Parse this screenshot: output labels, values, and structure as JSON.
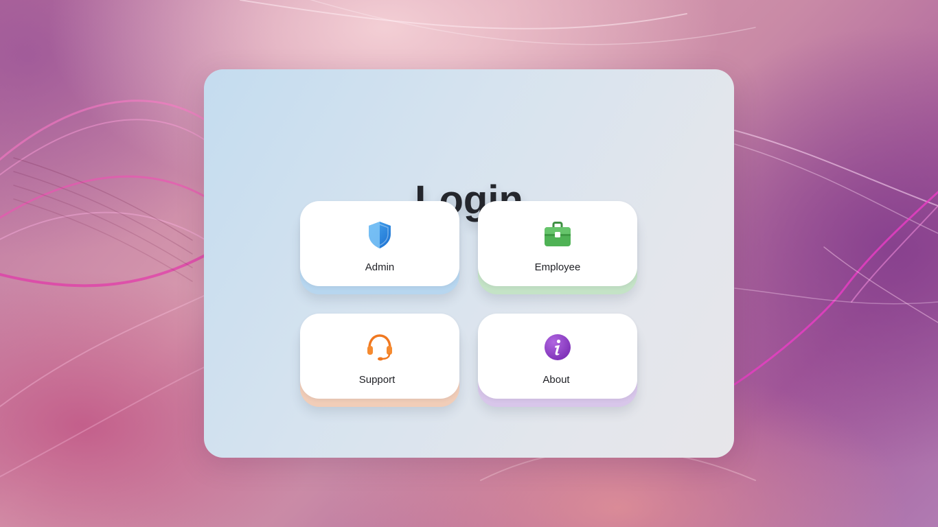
{
  "page": {
    "title": "Login"
  },
  "tiles": [
    {
      "id": "admin",
      "label": "Admin",
      "icon": "shield-icon",
      "accent": "#2f8de0"
    },
    {
      "id": "employee",
      "label": "Employee",
      "icon": "briefcase-icon",
      "accent": "#4caf50"
    },
    {
      "id": "support",
      "label": "Support",
      "icon": "headset-icon",
      "accent": "#f07820"
    },
    {
      "id": "about",
      "label": "About",
      "icon": "info-icon",
      "accent": "#8e3fc4"
    }
  ],
  "colors": {
    "title_text": "#24262c",
    "card_background": "#dbe4ee",
    "tile_background": "#ffffff"
  }
}
